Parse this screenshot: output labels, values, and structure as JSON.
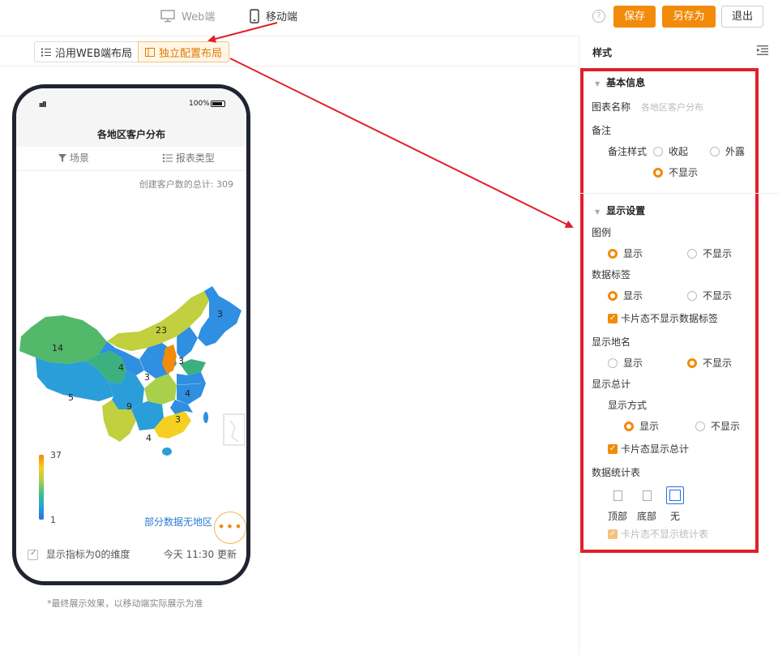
{
  "topbar": {
    "tab_web": "Web端",
    "tab_mobile": "移动端",
    "help": "?",
    "save": "保存",
    "save_as": "另存为",
    "exit": "退出"
  },
  "layout": {
    "follow_web": "沿用WEB端布局",
    "independent": "独立配置布局"
  },
  "phone": {
    "signal": "ııll",
    "battery": "100%",
    "chart_title": "各地区客户分布",
    "filter_scene": "场景",
    "filter_type": "报表类型",
    "total_text": "创建客户数的总计:  309",
    "legend_max": "37",
    "legend_min": "1",
    "no_region": "部分数据无地区",
    "more": "•••",
    "show_zero_dim": "显示指标为0的维度",
    "updated": "今天 11:30 更新",
    "map_labels": [
      "3",
      "23",
      "14",
      "4",
      "3",
      "3",
      "4",
      "5",
      "9",
      "3",
      "4"
    ]
  },
  "caption": "*最终展示效果，以移动端实际展示为准",
  "panel": {
    "title": "样式",
    "basic_section": "基本信息",
    "chart_name_label": "图表名称",
    "chart_name_placeholder": "各地区客户分布",
    "remark_label": "备注",
    "remark_style_label": "备注样式",
    "remark_collapse": "收起",
    "remark_expose": "外露",
    "remark_hide": "不显示",
    "display_section": "显示设置",
    "legend_label": "图例",
    "show": "显示",
    "hide": "不显示",
    "data_label": "数据标签",
    "card_no_data_label": "卡片态不显示数据标签",
    "show_place_name": "显示地名",
    "show_total": "显示总计",
    "display_mode": "显示方式",
    "card_show_total": "卡片态显示总计",
    "stat_table": "数据统计表",
    "stat_top": "顶部",
    "stat_bottom": "底部",
    "stat_none": "无",
    "card_no_stat": "卡片态不显示统计表"
  },
  "colors": {
    "accent": "#f28a0a",
    "highlight_box": "#e0202a",
    "link": "#2b7bd6"
  }
}
